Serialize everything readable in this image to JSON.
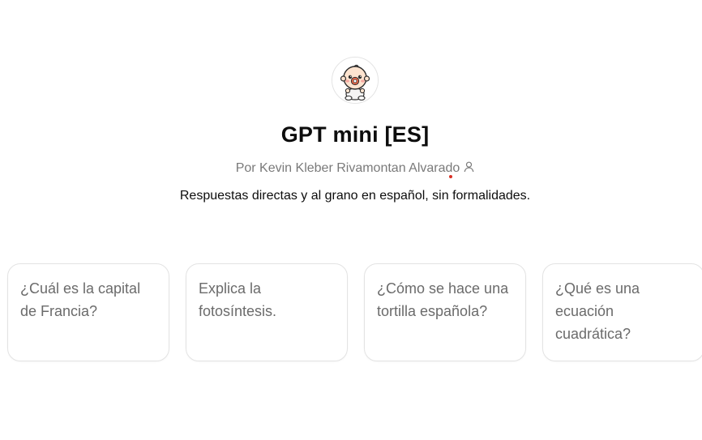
{
  "gpt": {
    "title": "GPT mini [ES]",
    "author_prefix": "Por ",
    "author": "Kevin Kleber Rivamontan Alvarado",
    "description": "Respuestas directas y al grano en español, sin formalidades.",
    "avatar_icon": "baby-mascot-icon",
    "author_icon": "person-icon"
  },
  "suggestions": [
    {
      "label": "¿Cuál es la capital de Francia?"
    },
    {
      "label": "Explica la fotosíntesis."
    },
    {
      "label": "¿Cómo se hace una tortilla española?"
    },
    {
      "label": "¿Qué es una ecuación cuadrática?"
    }
  ],
  "colors": {
    "text": "#0d0d0d",
    "muted": "#7a7a7a",
    "card_text": "#6b6b6b",
    "card_border": "#e3e3e3",
    "accent_dot": "#d93025"
  }
}
